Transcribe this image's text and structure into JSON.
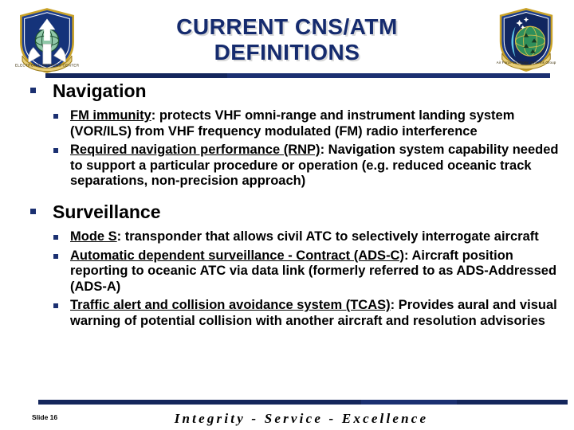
{
  "slide": {
    "title_lines": [
      "CURRENT CNS/ATM",
      "DEFINITIONS"
    ],
    "title_color": "#152b6e",
    "accent_color": "#1b3071",
    "background_color": "#ffffff",
    "logo_left_name": "electronic-systems-center-seal",
    "logo_right_name": "electronic-systems-group-seal"
  },
  "sections": [
    {
      "heading": "Navigation",
      "items": [
        {
          "term": "FM immunity",
          "separator": ":",
          "definition": " protects VHF omni-range and instrument landing system (VOR/ILS) from VHF frequency modulated (FM) radio interference"
        },
        {
          "term": "Required navigation performance (RNP)",
          "separator": ":",
          "definition": " Navigation system capability needed to support a particular procedure or operation (e.g. reduced oceanic track separations, non-precision approach)"
        }
      ]
    },
    {
      "heading": "Surveillance",
      "items": [
        {
          "term": "Mode S",
          "separator": ":",
          "definition": " transponder that allows civil ATC to selectively interrogate aircraft"
        },
        {
          "term": "Automatic dependent surveillance - Contract (ADS-C)",
          "separator": ":",
          "definition": " Aircraft position reporting to oceanic ATC via data link (formerly referred to as ADS-Addressed (ADS-A)"
        },
        {
          "term": "Traffic alert and collision avoidance system (TCAS)",
          "separator": ":",
          "definition": " Provides aural and visual warning of potential collision with another aircraft and resolution advisories"
        }
      ]
    }
  ],
  "footer": {
    "slide_number": "Slide 16",
    "motto": "Integrity - Service - Excellence"
  }
}
